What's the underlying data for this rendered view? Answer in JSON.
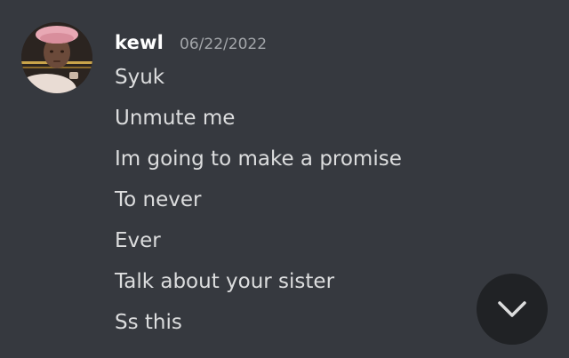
{
  "message": {
    "author": "kewl",
    "timestamp": "06/22/2022",
    "lines": [
      "Syuk",
      "Unmute me",
      "Im going to make a promise",
      "To never",
      "Ever",
      "Talk about your sister",
      "Ss this"
    ]
  },
  "scroll_button": {
    "icon": "chevron-down-icon"
  },
  "colors": {
    "background": "#36393f",
    "username": "#ffffff",
    "timestamp": "#a3a6aa",
    "message_text": "#dcddde",
    "scroll_button_bg": "#202225",
    "scroll_button_icon": "#dcddde"
  }
}
